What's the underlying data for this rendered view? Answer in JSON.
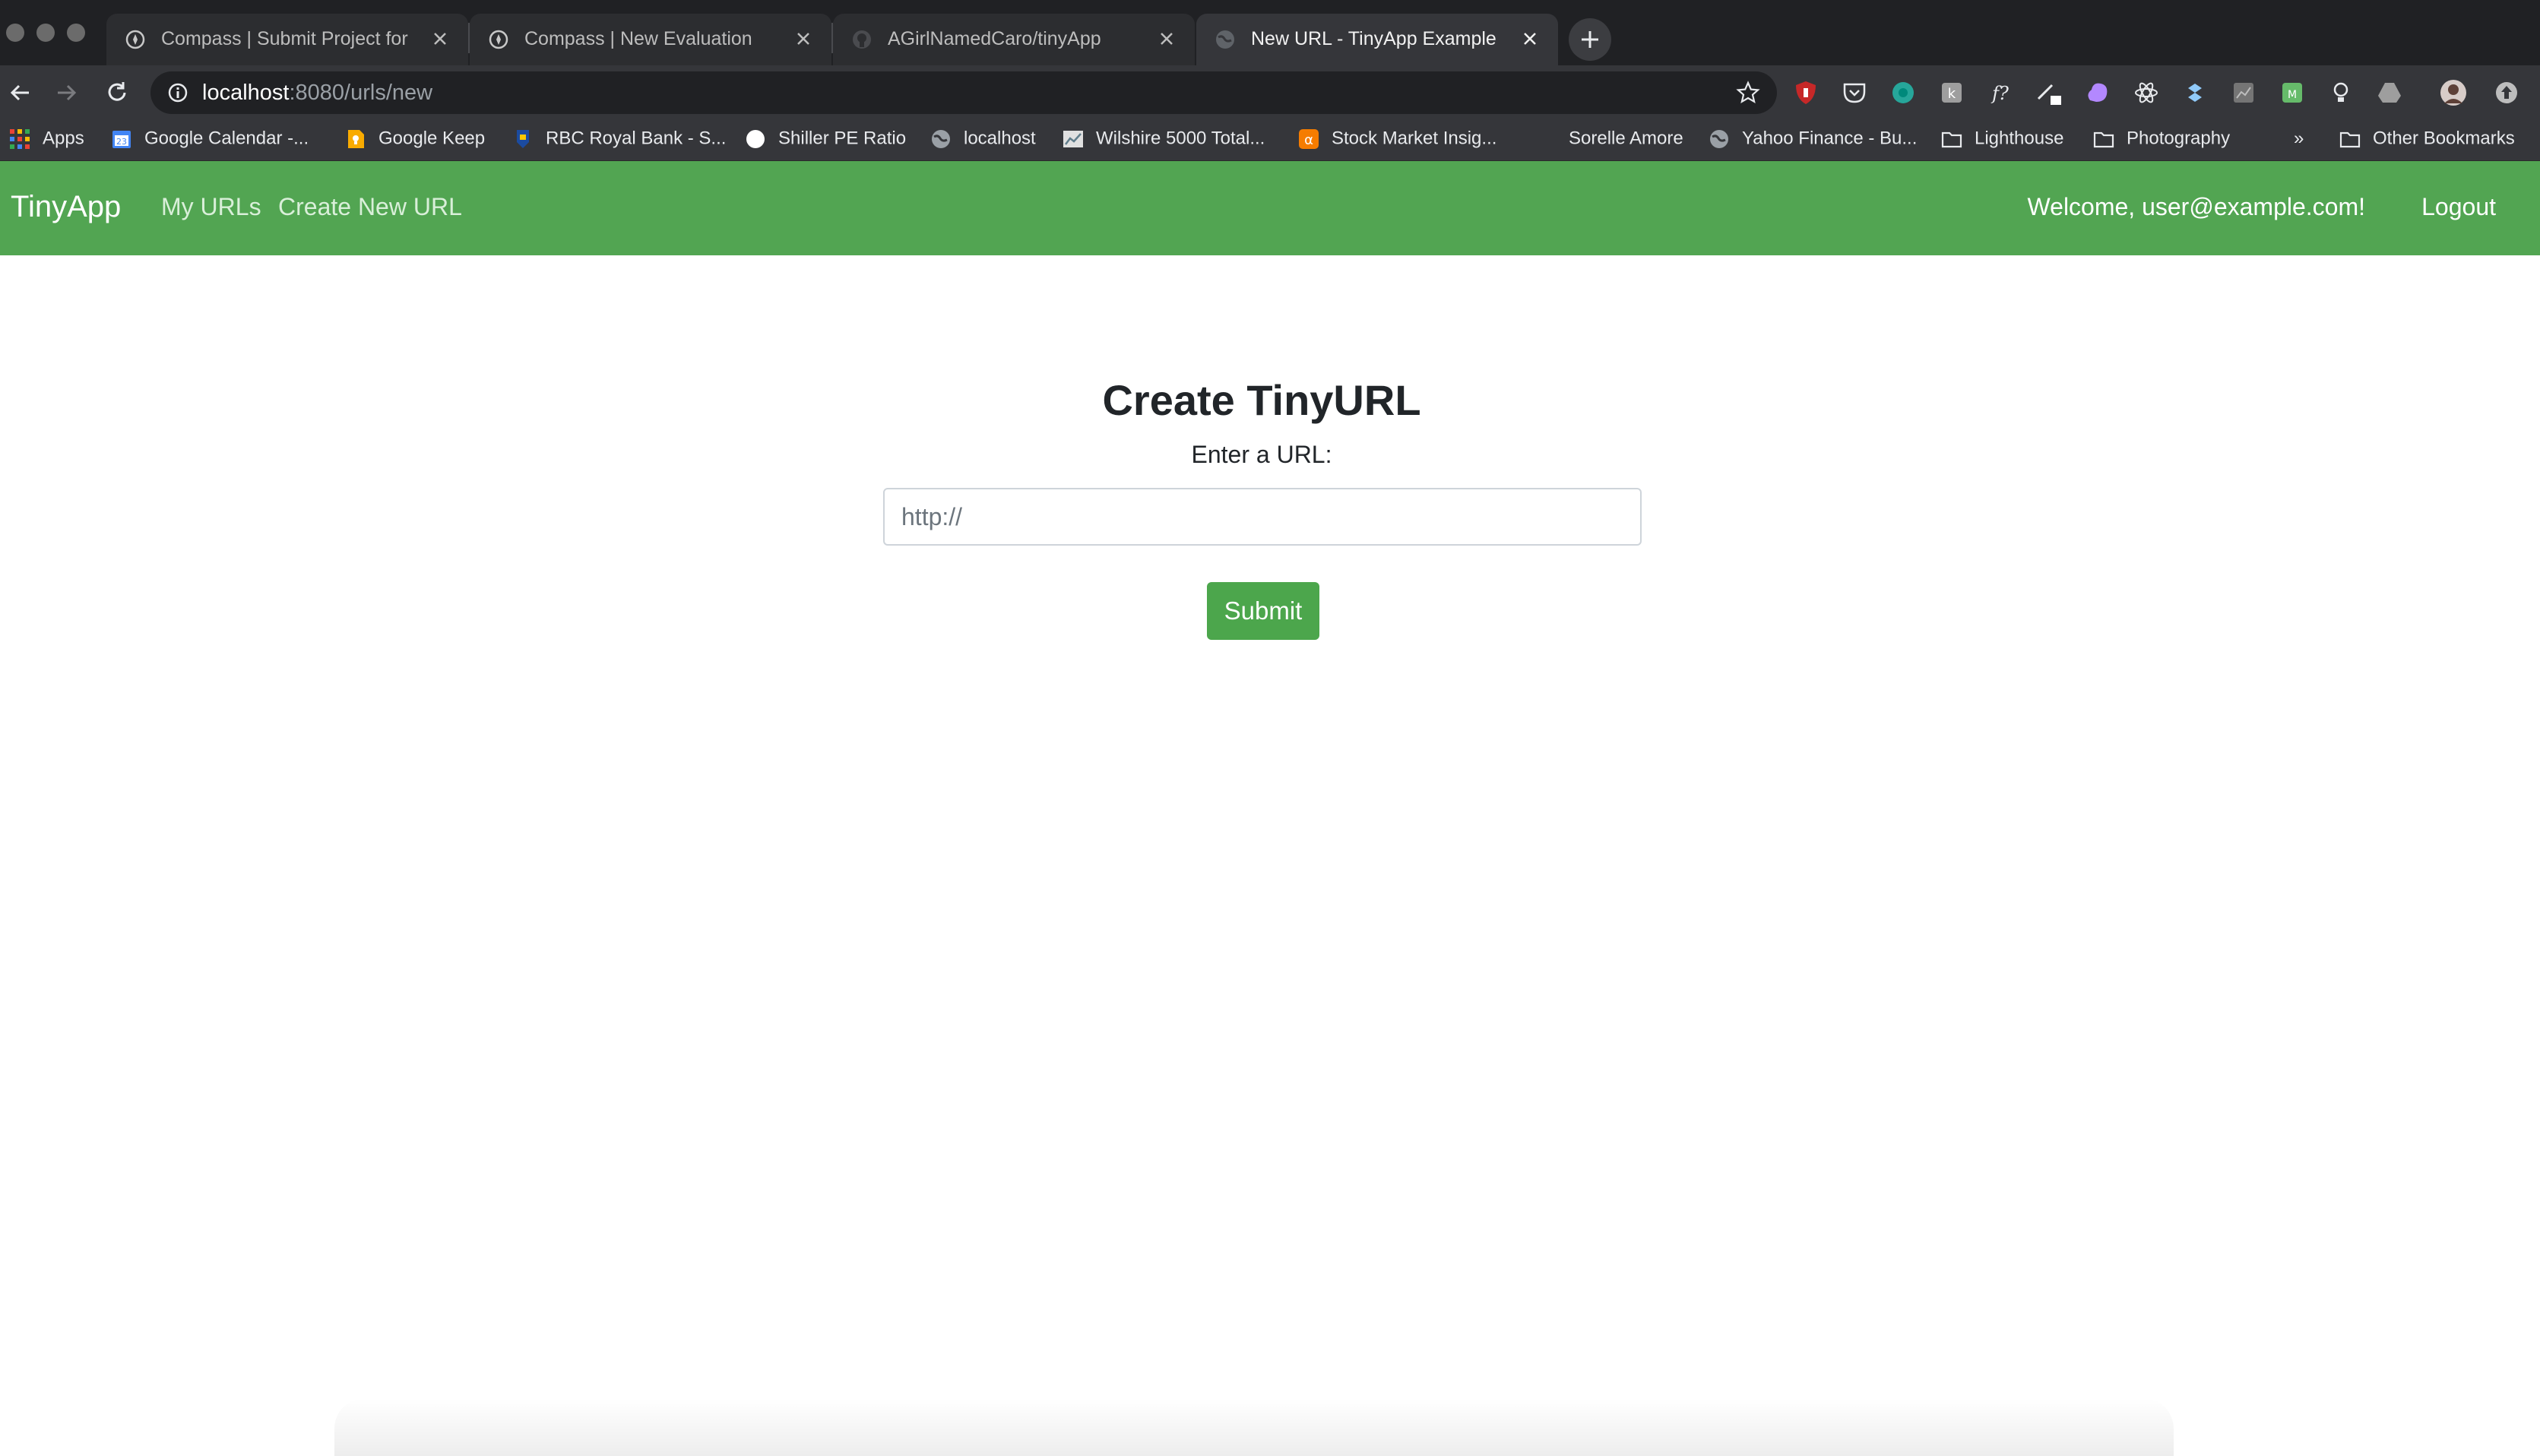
{
  "browser": {
    "tabs": [
      {
        "title": "Compass | Submit Project for Ev",
        "icon": "compass-icon",
        "active": false
      },
      {
        "title": "Compass | New Evaluation",
        "icon": "compass-icon",
        "active": false
      },
      {
        "title": "AGirlNamedCaro/tinyApp",
        "icon": "github-icon",
        "active": false
      },
      {
        "title": "New URL - TinyApp Example",
        "icon": "globe-icon",
        "active": true
      }
    ],
    "address": {
      "host": "localhost",
      "rest": ":8080/urls/new"
    },
    "bookmarks": [
      {
        "label": "Apps",
        "icon": "apps-grid-icon"
      },
      {
        "label": "Google Calendar -...",
        "icon": "calendar-icon"
      },
      {
        "label": "Google Keep",
        "icon": "keep-icon"
      },
      {
        "label": "RBC Royal Bank - S...",
        "icon": "rbc-icon"
      },
      {
        "label": "Shiller PE Ratio",
        "icon": "circle-icon"
      },
      {
        "label": "localhost",
        "icon": "globe-icon"
      },
      {
        "label": "Wilshire 5000 Total...",
        "icon": "chart-icon"
      },
      {
        "label": "Stock Market Insig...",
        "icon": "alpha-icon"
      },
      {
        "label": "Sorelle Amore",
        "icon": "blank-icon"
      },
      {
        "label": "Yahoo Finance - Bu...",
        "icon": "globe-icon"
      },
      {
        "label": "Lighthouse",
        "icon": "folder-icon"
      },
      {
        "label": "Photography",
        "icon": "folder-icon"
      },
      {
        "label": "»",
        "icon": "overflow-icon"
      },
      {
        "label": "Other Bookmarks",
        "icon": "folder-icon"
      }
    ],
    "extensions": [
      "ublock-icon",
      "pocket-icon",
      "teal-circle-icon",
      "puzzle-icon",
      "fx-icon",
      "pen-icon",
      "cloud-icon",
      "react-icon",
      "dropbox-icon",
      "chart-ext-icon",
      "green-square-icon",
      "bulb-icon",
      "drive-icon",
      "avatar",
      "update-icon"
    ]
  },
  "app": {
    "brand": "TinyApp",
    "nav": {
      "my_urls": "My URLs",
      "create_new": "Create New URL"
    },
    "welcome": "Welcome, user@example.com!",
    "logout": "Logout"
  },
  "form": {
    "title": "Create TinyURL",
    "label": "Enter a URL:",
    "placeholder": "http://",
    "submit": "Submit"
  },
  "colors": {
    "navbar": "#52a552",
    "button": "#4ca64c",
    "chrome_dark": "#202124",
    "chrome_mid": "#35363a"
  }
}
